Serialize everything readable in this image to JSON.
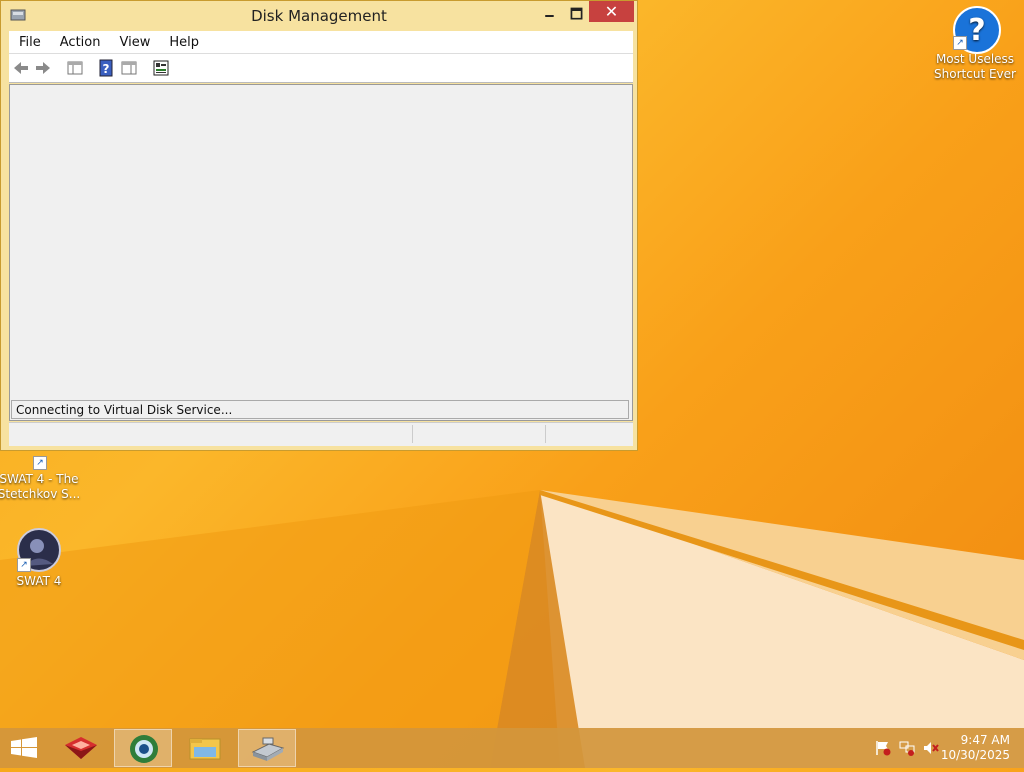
{
  "window": {
    "title": "Disk Management",
    "menu": [
      "File",
      "Action",
      "View",
      "Help"
    ],
    "status_message": "Connecting to Virtual Disk Service...",
    "buttons": {
      "minimize": "🗕",
      "maximize": "🗖",
      "close": "✕"
    }
  },
  "desktop": {
    "icons": [
      {
        "label": "Most Useless\nShortcut Ever",
        "icon": "question-icon"
      },
      {
        "label": "SWAT 4 - The\nStetchkov S...",
        "icon": "swat4-icon"
      },
      {
        "label": "SWAT 4",
        "icon": "swat4-icon"
      }
    ]
  },
  "taskbar": {
    "items": [
      "start-icon",
      "game-icon",
      "browser-icon",
      "file-explorer-icon",
      "disk-management-icon"
    ],
    "clock": {
      "time": "9:47 AM",
      "date": "10/30/2025"
    },
    "tray": [
      "action-center-flag-icon",
      "network-icon",
      "volume-muted-icon"
    ]
  },
  "colors": {
    "accent": "#fbb72a",
    "close": "#c7413f",
    "window_frame": "#f7e2a0"
  }
}
